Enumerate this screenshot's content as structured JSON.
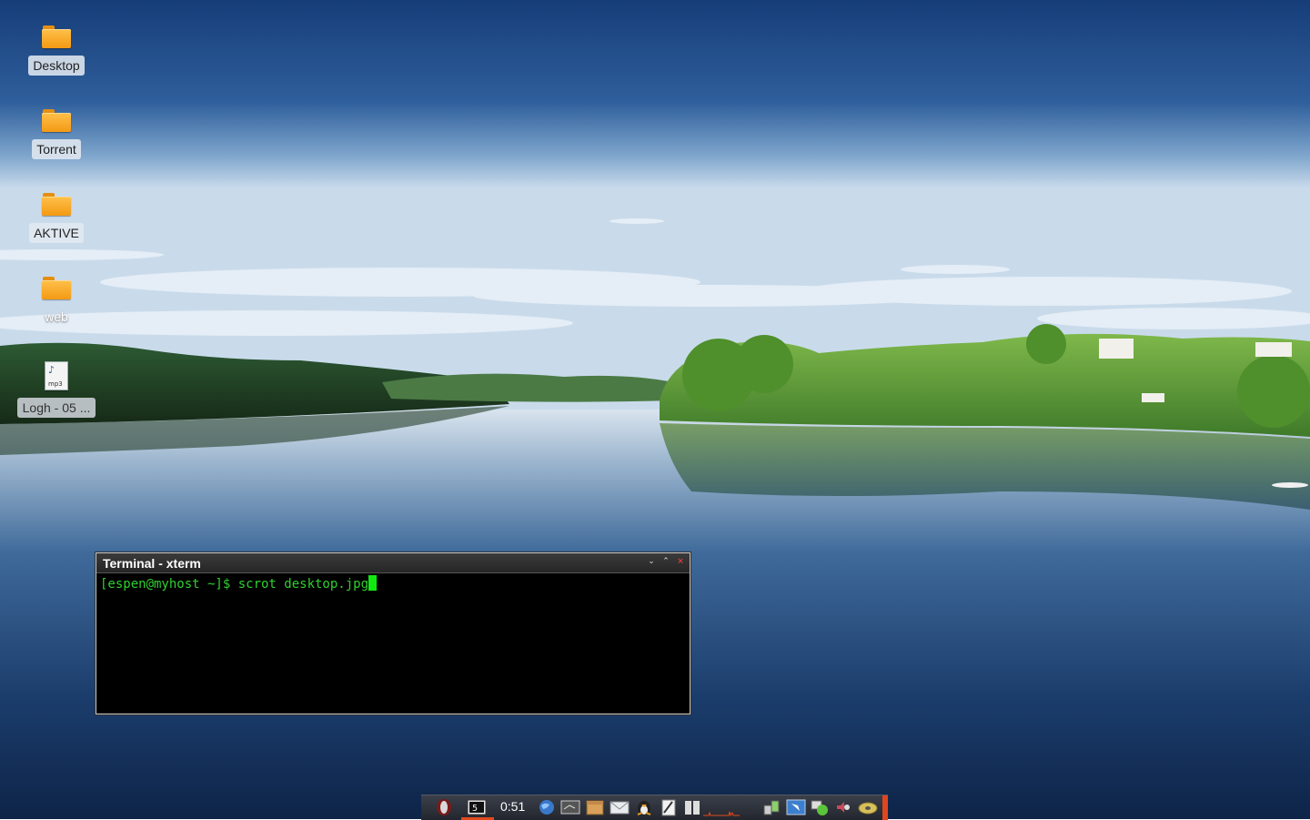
{
  "desktop": {
    "icons": [
      {
        "label": "Desktop",
        "type": "folder",
        "icon": "folder-icon"
      },
      {
        "label": "Torrent",
        "type": "folder",
        "icon": "folder-icon"
      },
      {
        "label": "AKTIVE",
        "type": "folder",
        "icon": "folder-icon"
      },
      {
        "label": "web",
        "type": "folder",
        "icon": "folder-icon"
      },
      {
        "label": "Logh - 05 ...",
        "type": "file",
        "icon": "mp3-file-icon",
        "ext": "mp3"
      }
    ]
  },
  "terminal": {
    "title": "Terminal - xterm",
    "prompt": "[espen@myhost ~]$ ",
    "command": "scrot desktop.jpg",
    "colors": {
      "text": "#2fd02f",
      "cursor": "#11e811",
      "background": "#000000"
    }
  },
  "taskbar": {
    "clock": "0:51",
    "accent": "#e0461c",
    "launchers": [
      "app-menu-icon",
      "terminal-app-icon",
      "globe-icon",
      "monitor-icon",
      "archive-icon",
      "mail-icon",
      "penguin-icon",
      "text-editor-icon",
      "pager-icon",
      "cpu-graph-icon",
      "network-icon",
      "window-switch-icon",
      "chat-icon",
      "volume-icon",
      "disc-icon"
    ]
  }
}
